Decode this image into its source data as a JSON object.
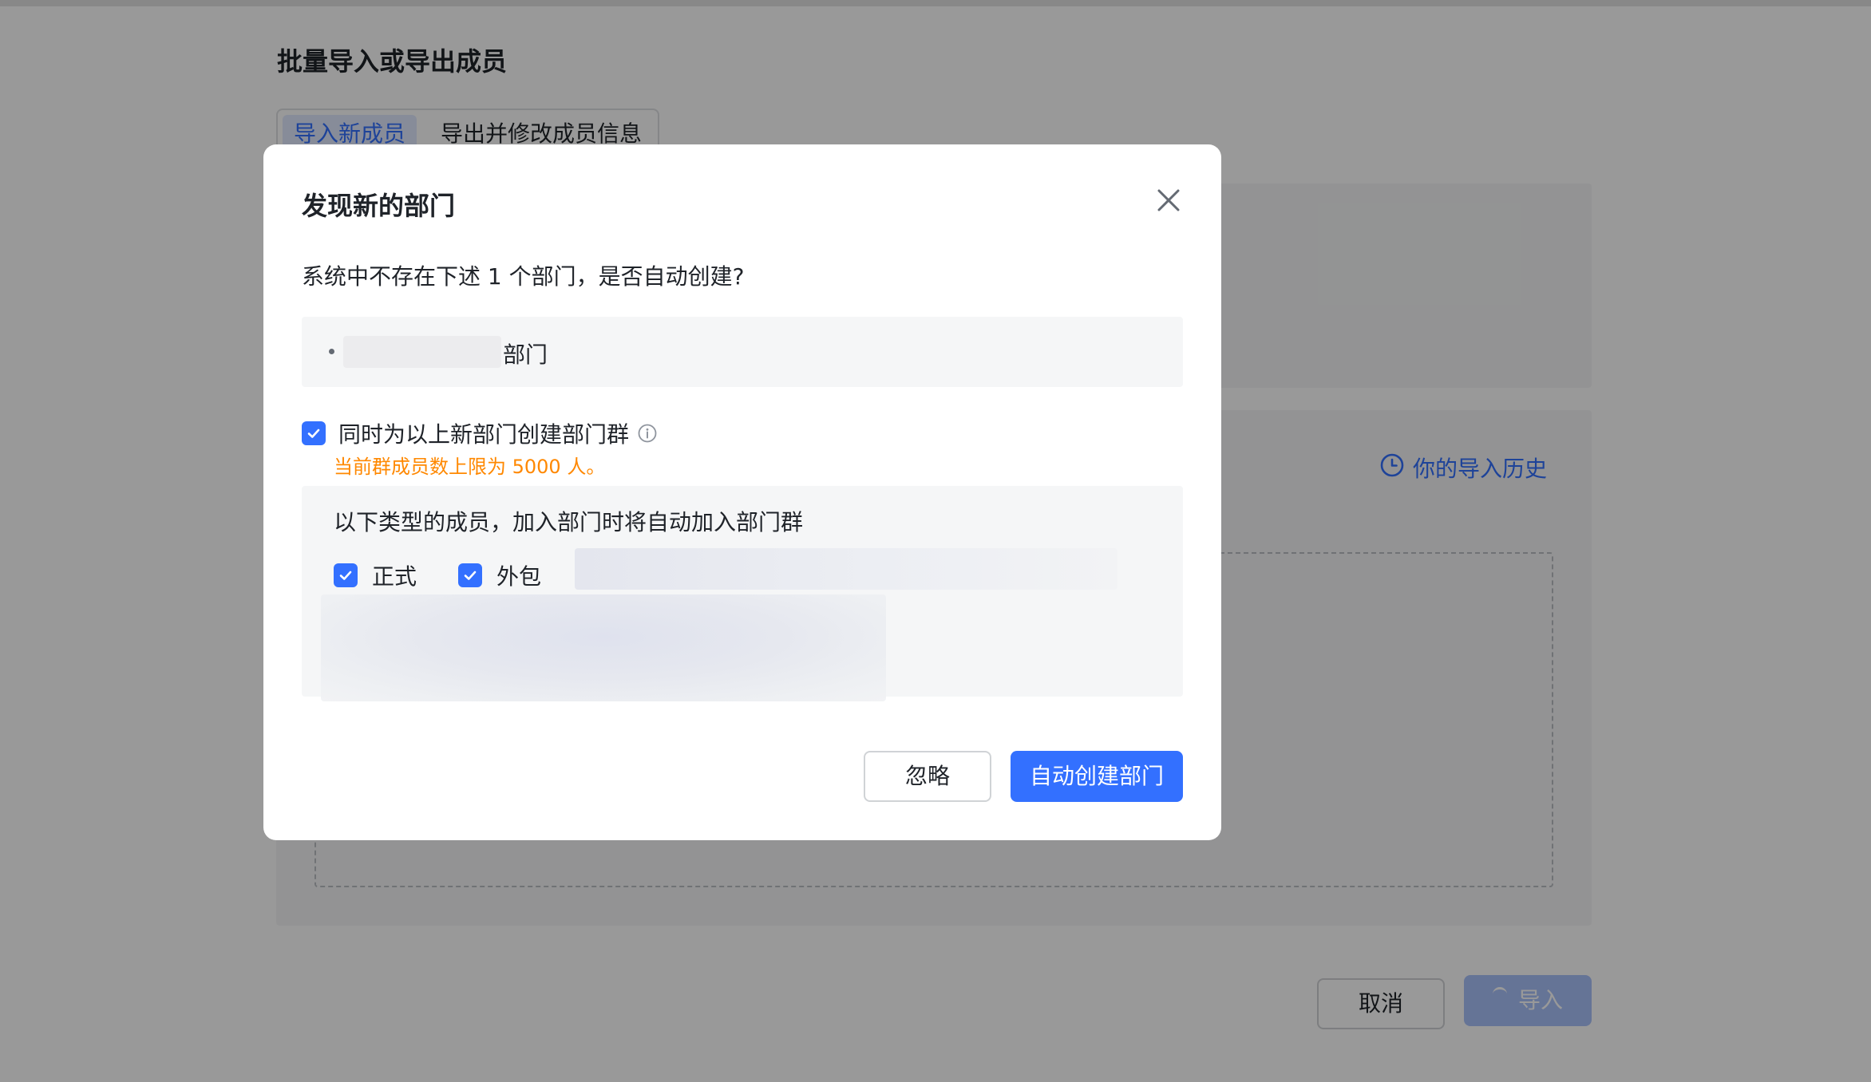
{
  "page": {
    "title": "批量导入或导出成员",
    "tabs": [
      {
        "label": "导入新成员",
        "active": true
      },
      {
        "label": "导出并修改成员信息",
        "active": false
      }
    ],
    "history_link": "你的导入历史",
    "cancel_label": "取消",
    "import_label": "导入"
  },
  "modal": {
    "title": "发现新的部门",
    "description": "系统中不存在下述 1 个部门，是否自动创建?",
    "departments": [
      {
        "suffix": "部门"
      }
    ],
    "create_group": {
      "checked": true,
      "label": "同时为以上新部门创建部门群",
      "note": "当前群成员数上限为 5000 人。"
    },
    "member_types": {
      "title": "以下类型的成员，加入部门时将自动加入部门群",
      "options": [
        {
          "label": "正式",
          "checked": true
        },
        {
          "label": "外包",
          "checked": true
        }
      ]
    },
    "ignore_label": "忽略",
    "create_label": "自动创建部门"
  },
  "colors": {
    "primary": "#3370ff",
    "warning": "#ff8800",
    "mask": "rgba(0,0,0,0.40)"
  },
  "icons": [
    "close-icon",
    "checkmark-icon",
    "info-icon",
    "clock-icon",
    "loading-spinner-icon"
  ]
}
